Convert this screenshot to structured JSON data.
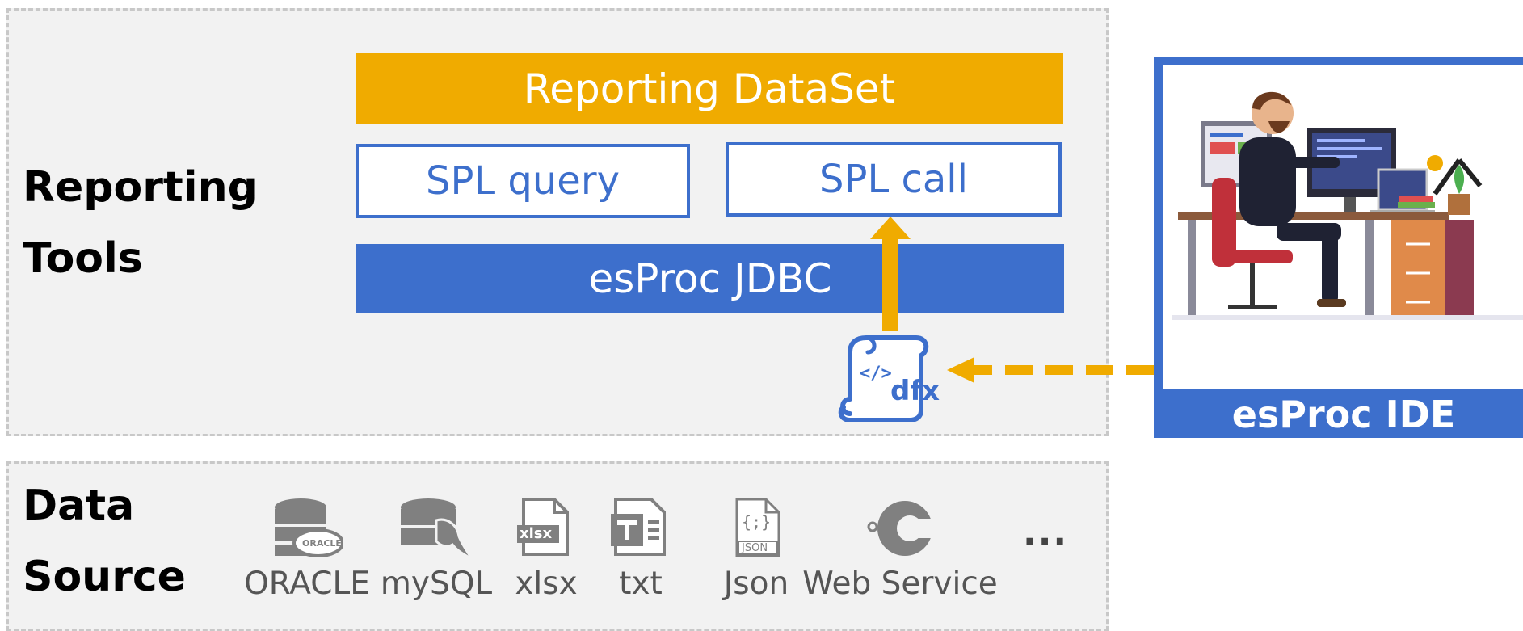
{
  "reporting_tools": {
    "label_line1": "Reporting",
    "label_line2": "Tools",
    "dataset_label": "Reporting DataSet",
    "spl_query_label": "SPL query",
    "spl_call_label": "SPL call",
    "jdbc_label": "esProc JDBC",
    "dfx_label": "dfx",
    "dfx_code": "</>"
  },
  "ide": {
    "label": "esProc IDE",
    "icon": "developer-at-desk-illustration"
  },
  "data_source": {
    "label_line1": "Data",
    "label_line2": "Source",
    "oracle_logo_text": "ORACLE",
    "xlsx_icon_text": "xlsx",
    "json_icon_text": "JSON",
    "json_icon_glyph": "{;}",
    "items": [
      {
        "label": "ORACLE",
        "icon": "oracle-database-icon"
      },
      {
        "label": "mySQL",
        "icon": "mysql-database-icon"
      },
      {
        "label": "xlsx",
        "icon": "xlsx-file-icon"
      },
      {
        "label": "txt",
        "icon": "txt-file-icon"
      },
      {
        "label": "Json",
        "icon": "json-file-icon"
      },
      {
        "label": "Web Service",
        "icon": "web-service-icon"
      }
    ],
    "more": "..."
  },
  "colors": {
    "gold": "#f0ab00",
    "blue": "#3d6fcc",
    "panel_bg": "#f2f2f2",
    "icon_gray": "#808080"
  }
}
